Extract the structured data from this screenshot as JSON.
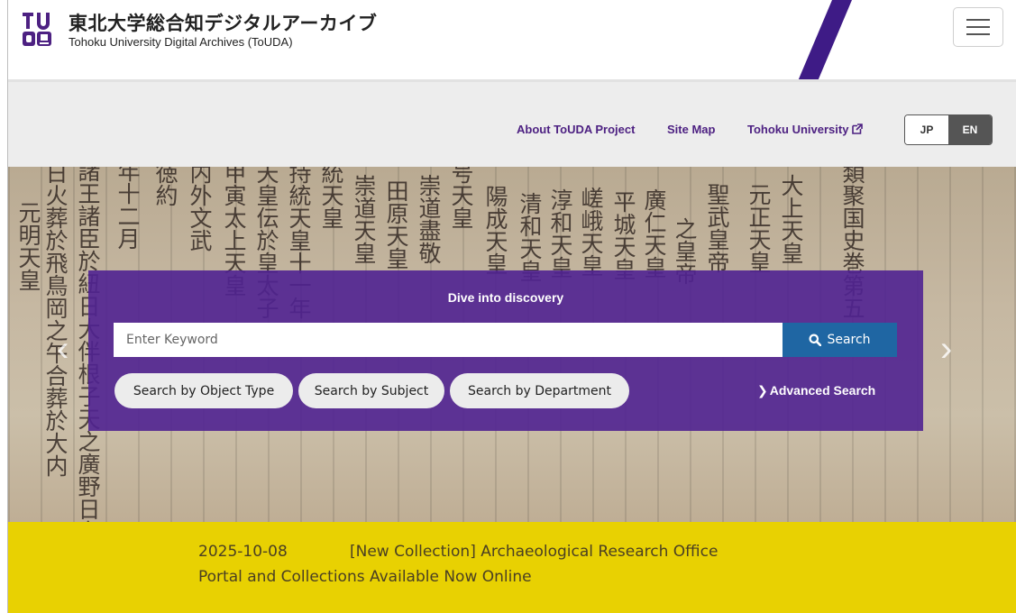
{
  "header": {
    "title_jp": "東北大学総合知デジタルアーカイブ",
    "title_en": "Tohoku University Digital Archives (ToUDA)",
    "logo_icon": "toudа-logo-icon",
    "menu_icon": "hamburger-menu-icon"
  },
  "nav": {
    "links": [
      "About ToUDA Project",
      "Site Map",
      "Tohoku University"
    ],
    "external_icon": "external-link-icon",
    "languages": [
      "JP",
      "EN"
    ],
    "active_language": "EN"
  },
  "hero": {
    "calligraphy_columns": [
      "元明天皇",
      "日火葬於飛鳥岡之午合葬於大内",
      "諸王諸臣於紐日大伴根子天之廣野日女",
      "年十二月",
      "徳約",
      "内外文武",
      "甲寅太上天皇",
      "天皇伝於皇太子",
      "持統天皇十一年",
      "統天皇",
      "崇道天皇",
      "田原天皇",
      "崇道盡敬",
      "号天皇",
      "陽成天皇",
      "清和天皇",
      "淳和天皇",
      "嵯峨天皇",
      "平城天皇",
      "廣仁天皇",
      "之皇帝",
      "聖武皇帝",
      "元正天皇",
      "大上天皇",
      "類聚国史巻第五"
    ],
    "prev_icon": "chevron-left-icon",
    "next_icon": "chevron-right-icon"
  },
  "search": {
    "heading": "Dive into discovery",
    "placeholder": "Enter Keyword",
    "button_label": "Search",
    "search_icon": "search-icon",
    "filters": [
      "Search by Object Type",
      "Search by Subject",
      "Search by Department"
    ],
    "advanced_label": "Advanced Search"
  },
  "news": {
    "date": "2025-10-08",
    "line1": "[New Collection] Archaeological Research Office",
    "line2": "Portal and Collections Available Now Online"
  },
  "colors": {
    "purple": "#4d2182",
    "search_panel": "#502291",
    "search_button": "#1f66a3",
    "news_bg": "#e8d102"
  }
}
